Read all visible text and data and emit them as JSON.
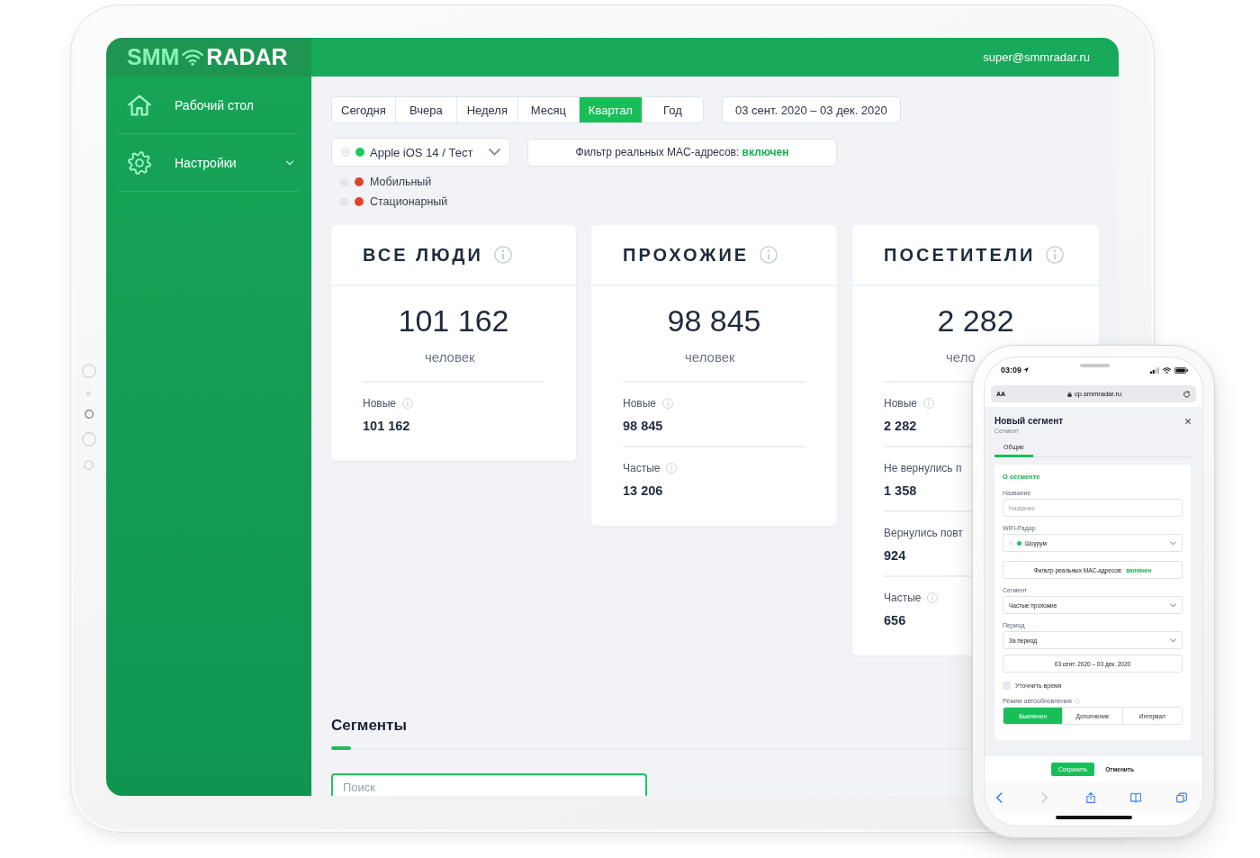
{
  "tablet": {
    "logo": {
      "accent": "SMM",
      "main": "RADAR"
    },
    "user_email": "super@smmradar.ru",
    "sidebar": {
      "items": [
        {
          "kind": "home",
          "label": "Рабочий стол",
          "has_submenu": false
        },
        {
          "kind": "settings",
          "label": "Настройки",
          "has_submenu": true
        }
      ]
    },
    "period_tabs": [
      {
        "label": "Сегодня",
        "selected": false
      },
      {
        "label": "Вчера",
        "selected": false
      },
      {
        "label": "Неделя",
        "selected": false
      },
      {
        "label": "Месяц",
        "selected": false
      },
      {
        "label": "Квартал",
        "selected": true
      },
      {
        "label": "Год",
        "selected": false
      }
    ],
    "date_range": "03 сент. 2020 – 03 дек. 2020",
    "radar_select": {
      "value": "Apple iOS 14 / Тест",
      "color": "#1fc75f"
    },
    "radar_list": [
      {
        "name": "Мобильный",
        "color": "#e0452b"
      },
      {
        "name": "Стационарный",
        "color": "#e0452b"
      }
    ],
    "mac_filter": {
      "label": "Фильтр реальных MAC-адресов:",
      "status": "включен",
      "on": true
    },
    "cards": [
      {
        "title": "ВСЕ ЛЮДИ",
        "total": "101 162",
        "unit": "человек",
        "stats": [
          {
            "label": "Новые",
            "value": "101 162",
            "info": true
          }
        ]
      },
      {
        "title": "ПРОХОЖИЕ",
        "total": "98 845",
        "unit": "человек",
        "stats": [
          {
            "label": "Новые",
            "value": "98 845",
            "info": true
          },
          {
            "label": "Частые",
            "value": "13 206",
            "info": true
          }
        ]
      },
      {
        "title": "ПОСЕТИТЕЛИ",
        "total": "2 282",
        "unit": "чело",
        "stats": [
          {
            "label": "Новые",
            "value": "2 282",
            "info": true
          },
          {
            "label": "Не вернулись п",
            "value": "1 358",
            "info": false
          },
          {
            "label": "Вернулись повт",
            "value": "924",
            "info": false
          },
          {
            "label": "Частые",
            "value": "656",
            "info": true
          }
        ]
      }
    ],
    "segments": {
      "title": "Сегменты",
      "search": {
        "placeholder": "Поиск"
      }
    }
  },
  "phone": {
    "status_bar": {
      "time": "03:09"
    },
    "url_bar": {
      "text_size": "AA",
      "url": "cp.smmradar.ru"
    },
    "modal": {
      "title": "Новый сегмент",
      "subtitle": "Сегмент",
      "tabs": [
        {
          "label": "Общие",
          "selected": true
        }
      ],
      "section_title": "О сегменте",
      "fields": [
        {
          "kind": "input",
          "label": "Название",
          "placeholder": "Название"
        },
        {
          "kind": "select",
          "label": "WiFi-Радар",
          "value": "Шоурум",
          "color": "#1fc75f"
        },
        {
          "kind": "toggle",
          "text": "Фильтр реальных MAC-адресов:",
          "status": "включен",
          "on": true
        },
        {
          "kind": "select",
          "label": "Сегмент",
          "value": "Частые прохожие"
        },
        {
          "kind": "select",
          "label": "Период",
          "value": "За период"
        },
        {
          "kind": "button",
          "text": "03 сент. 2020 – 03 дек. 2020"
        },
        {
          "kind": "checkbox",
          "label": "Уточнить время",
          "checked": false
        },
        {
          "kind": "segmented",
          "label": "Режим автообновления",
          "info": true,
          "options": [
            {
              "label": "Выключен",
              "selected": true
            },
            {
              "label": "Дополнение",
              "selected": false
            },
            {
              "label": "Интервал",
              "selected": false
            }
          ]
        }
      ],
      "actions": [
        {
          "kind": "primary",
          "label": "Сохранить"
        },
        {
          "kind": "secondary",
          "label": "Отменить"
        }
      ]
    },
    "toolbar": [
      {
        "kind": "back",
        "disabled": false
      },
      {
        "kind": "forward",
        "disabled": true
      },
      {
        "kind": "share",
        "disabled": false
      },
      {
        "kind": "bookmarks",
        "disabled": false
      },
      {
        "kind": "tabs",
        "disabled": false
      }
    ]
  }
}
